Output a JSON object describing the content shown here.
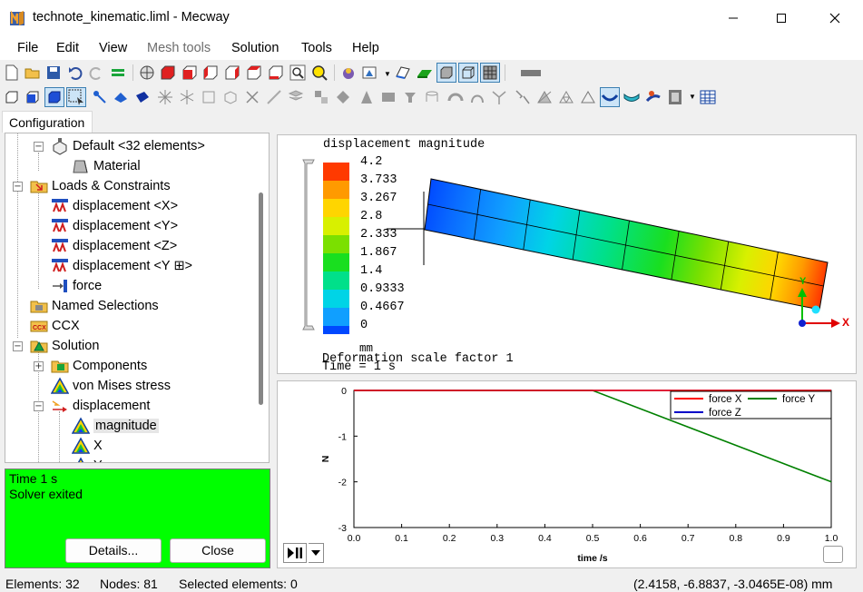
{
  "window": {
    "title": "technote_kinematic.liml - Mecway",
    "minimize_icon": "minimize-icon",
    "maximize_icon": "maximize-icon",
    "close_icon": "close-icon"
  },
  "menu": {
    "items": [
      "File",
      "Edit",
      "View",
      "Mesh tools",
      "Solution",
      "Tools",
      "Help"
    ],
    "disabled": [
      "Mesh tools"
    ]
  },
  "tabs": {
    "configuration": "Configuration"
  },
  "tree": {
    "items": [
      {
        "label": "Default <32 elements>",
        "icon": "element-group-icon"
      },
      {
        "label": "Material",
        "icon": "material-icon"
      },
      {
        "label": "Loads & Constraints",
        "icon": "loads-folder-icon"
      },
      {
        "label": "displacement <X>",
        "icon": "displacement-constraint-icon"
      },
      {
        "label": "displacement <Y>",
        "icon": "displacement-constraint-icon"
      },
      {
        "label": "displacement <Z>",
        "icon": "displacement-constraint-icon"
      },
      {
        "label": "displacement <Y ⊞>",
        "icon": "displacement-constraint-icon"
      },
      {
        "label": "force",
        "icon": "force-icon"
      },
      {
        "label": "Named Selections",
        "icon": "named-selections-icon"
      },
      {
        "label": "CCX",
        "icon": "ccx-icon"
      },
      {
        "label": "Solution",
        "icon": "solution-icon"
      },
      {
        "label": "Components",
        "icon": "components-icon"
      },
      {
        "label": "von Mises stress",
        "icon": "contour-result-icon"
      },
      {
        "label": "displacement",
        "icon": "vector-result-icon"
      },
      {
        "label": "magnitude",
        "icon": "contour-result-icon"
      },
      {
        "label": "X",
        "icon": "contour-result-icon"
      },
      {
        "label": "Y",
        "icon": "contour-result-icon"
      }
    ],
    "selected": "magnitude"
  },
  "solver_panel": {
    "lines": [
      "Time 1 s",
      "Solver exited"
    ],
    "details_button": "Details...",
    "close_button": "Close",
    "background": "#00ff00"
  },
  "view3d": {
    "result_title": "displacement magnitude",
    "unit": "mm",
    "scale_factor_text": "Deformation scale factor 1",
    "time_text": "Time = 1 s",
    "legend_values": [
      "4.2",
      "3.733",
      "3.267",
      "2.8",
      "2.333",
      "1.867",
      "1.4",
      "0.9333",
      "0.4667",
      "0"
    ],
    "legend_colors": [
      "#ff3a00",
      "#ff9a00",
      "#ffd500",
      "#d8f000",
      "#7be000",
      "#19df1f",
      "#00e08a",
      "#00d4e6",
      "#109fff",
      "#0048ff"
    ],
    "axis_x_label": "X",
    "axis_y_label": "Y"
  },
  "chart_data": {
    "type": "line",
    "title": "",
    "xlabel": "time /s",
    "ylabel": "N",
    "xlim": [
      0,
      1
    ],
    "ylim": [
      -3,
      0
    ],
    "x_ticks": [
      "0.0",
      "0.1",
      "0.2",
      "0.3",
      "0.4",
      "0.5",
      "0.6",
      "0.7",
      "0.8",
      "0.9",
      "1.0"
    ],
    "y_ticks": [
      "0",
      "-1",
      "-2",
      "-3"
    ],
    "legend": "top-right",
    "series": [
      {
        "name": "force X",
        "color": "#ff0000",
        "x": [
          0,
          1.0
        ],
        "y": [
          0,
          0
        ]
      },
      {
        "name": "force Y",
        "color": "#008000",
        "x": [
          0,
          0.5,
          1.0
        ],
        "y": [
          0,
          0,
          -2
        ]
      },
      {
        "name": "force Z",
        "color": "#0000c8",
        "x": [
          0,
          1.0
        ],
        "y": [
          0,
          0
        ]
      }
    ]
  },
  "statusbar": {
    "elements": "Elements: 32",
    "nodes": "Nodes: 81",
    "selected": "Selected elements: 0",
    "coords": "(2.4158, -6.8837, -3.0465E-08) mm"
  }
}
